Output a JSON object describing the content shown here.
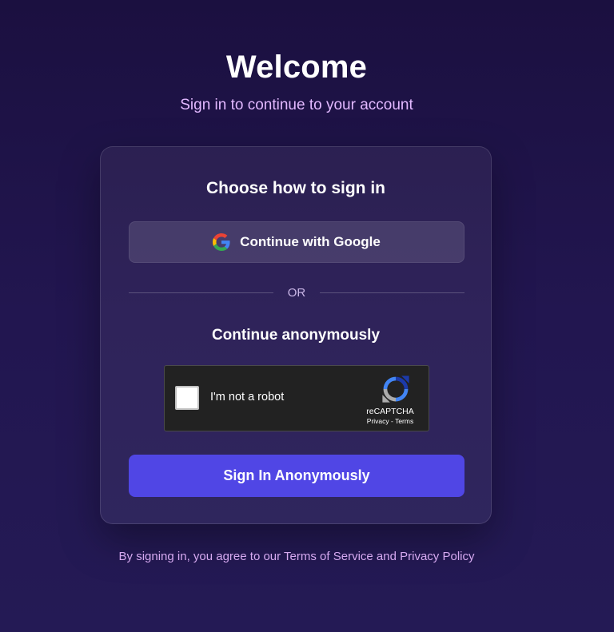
{
  "header": {
    "title": "Welcome",
    "subtitle": "Sign in to continue to your account"
  },
  "card": {
    "heading": "Choose how to sign in",
    "google_button_label": "Continue with Google",
    "divider_text": "OR",
    "anon_heading": "Continue anonymously",
    "recaptcha": {
      "label": "I'm not a robot",
      "brand": "reCAPTCHA",
      "privacy": "Privacy",
      "separator": " - ",
      "terms": "Terms",
      "checked": false
    },
    "anon_button_label": "Sign In Anonymously"
  },
  "footer": {
    "prefix": "By signing in, you agree to our ",
    "terms_link": "Terms of Service",
    "conjunction": " and ",
    "privacy_link": "Privacy Policy"
  },
  "colors": {
    "primary_button": "#5046e5",
    "subtitle": "#e2b8ff",
    "background_top": "#1b1040",
    "background_bottom": "#241a55"
  },
  "icons": {
    "google": "google-icon",
    "recaptcha": "recaptcha-logo-icon"
  }
}
